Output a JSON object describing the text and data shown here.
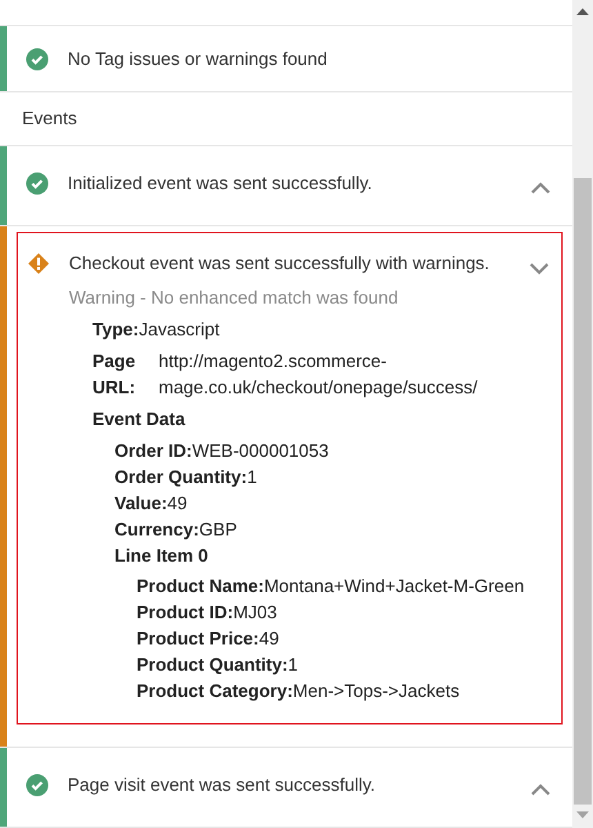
{
  "tag_status": {
    "kind": "success",
    "text": "No Tag issues or warnings found"
  },
  "events_heading": "Events",
  "events": [
    {
      "kind": "success",
      "title": "Initialized event was sent successfully.",
      "expanded": false
    },
    {
      "kind": "warning",
      "title": "Checkout event was sent successfully with warnings.",
      "expanded": true,
      "warning": "Warning - No enhanced match was found",
      "details": {
        "type_label": "Type:",
        "type_value": "Javascript",
        "page_url_label": "Page URL:",
        "page_url_value": "http://magento2.scommerce-mage.co.uk/checkout/onepage/success/",
        "event_data_title": "Event Data",
        "fields": [
          {
            "label": "Order ID:",
            "value": "WEB-000001053"
          },
          {
            "label": "Order Quantity:",
            "value": "1"
          },
          {
            "label": "Value:",
            "value": "49"
          },
          {
            "label": "Currency:",
            "value": "GBP"
          }
        ],
        "line_item": {
          "title": "Line Item 0",
          "fields": [
            {
              "label": "Product Name:",
              "value": "Montana+Wind+Jacket-M-Green"
            },
            {
              "label": "Product ID:",
              "value": "MJ03"
            },
            {
              "label": "Product Price:",
              "value": "49"
            },
            {
              "label": "Product Quantity:",
              "value": "1"
            },
            {
              "label": "Product Category:",
              "value": "Men->Tops->Jackets"
            }
          ]
        }
      }
    },
    {
      "kind": "success",
      "title": "Page visit event was sent successfully.",
      "expanded": false
    }
  ]
}
